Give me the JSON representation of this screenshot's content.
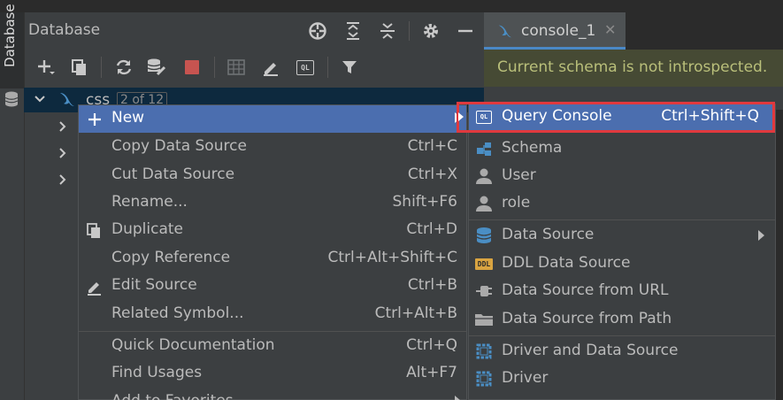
{
  "side_strip": {
    "tab_label": "Database"
  },
  "panel": {
    "title": "Database",
    "header_icons": [
      "crosshair-icon",
      "expand-all-icon",
      "collapse-all-icon",
      "gear-icon",
      "minimize-icon"
    ],
    "toolbar_icons": [
      "add-icon",
      "copy-icon",
      "refresh-icon",
      "db-properties-icon",
      "stop-icon",
      "table-icon",
      "edit-icon",
      "query-console-icon",
      "filter-icon"
    ]
  },
  "tree": {
    "root_label": "css",
    "root_badge": "2 of 12"
  },
  "editor": {
    "tab_label": "console_1",
    "tab_close": "✕",
    "banner": "Current schema is not introspected."
  },
  "context_menu": {
    "items": [
      {
        "label": "New",
        "shortcut": ""
      },
      {
        "label": "Copy Data Source",
        "shortcut": "Ctrl+C"
      },
      {
        "label": "Cut Data Source",
        "shortcut": "Ctrl+X"
      },
      {
        "label": "Rename...",
        "shortcut": "Shift+F6"
      },
      {
        "label": "Duplicate",
        "shortcut": "Ctrl+D"
      },
      {
        "label": "Copy Reference",
        "shortcut": "Ctrl+Alt+Shift+C"
      },
      {
        "label": "Edit Source",
        "shortcut": "Ctrl+B"
      },
      {
        "label": "Related Symbol...",
        "shortcut": "Ctrl+Alt+B"
      },
      {
        "label": "Quick Documentation",
        "shortcut": "Ctrl+Q"
      },
      {
        "label": "Find Usages",
        "shortcut": "Alt+F7"
      },
      {
        "label": "Add to Favorites",
        "shortcut": ""
      }
    ]
  },
  "submenu": {
    "items": [
      {
        "label": "Query Console",
        "shortcut": "Ctrl+Shift+Q"
      },
      {
        "label": "Schema",
        "shortcut": ""
      },
      {
        "label": "User",
        "shortcut": ""
      },
      {
        "label": "role",
        "shortcut": ""
      },
      {
        "label": "Data Source",
        "shortcut": ""
      },
      {
        "label": "DDL Data Source",
        "shortcut": ""
      },
      {
        "label": "Data Source from URL",
        "shortcut": ""
      },
      {
        "label": "Data Source from Path",
        "shortcut": ""
      },
      {
        "label": "Driver and Data Source",
        "shortcut": ""
      },
      {
        "label": "Driver",
        "shortcut": ""
      }
    ]
  },
  "colors": {
    "selection": "#4b6eaf",
    "highlight_border": "#e0393e",
    "banner_bg": "#464a34",
    "banner_text": "#b9bf7a"
  }
}
